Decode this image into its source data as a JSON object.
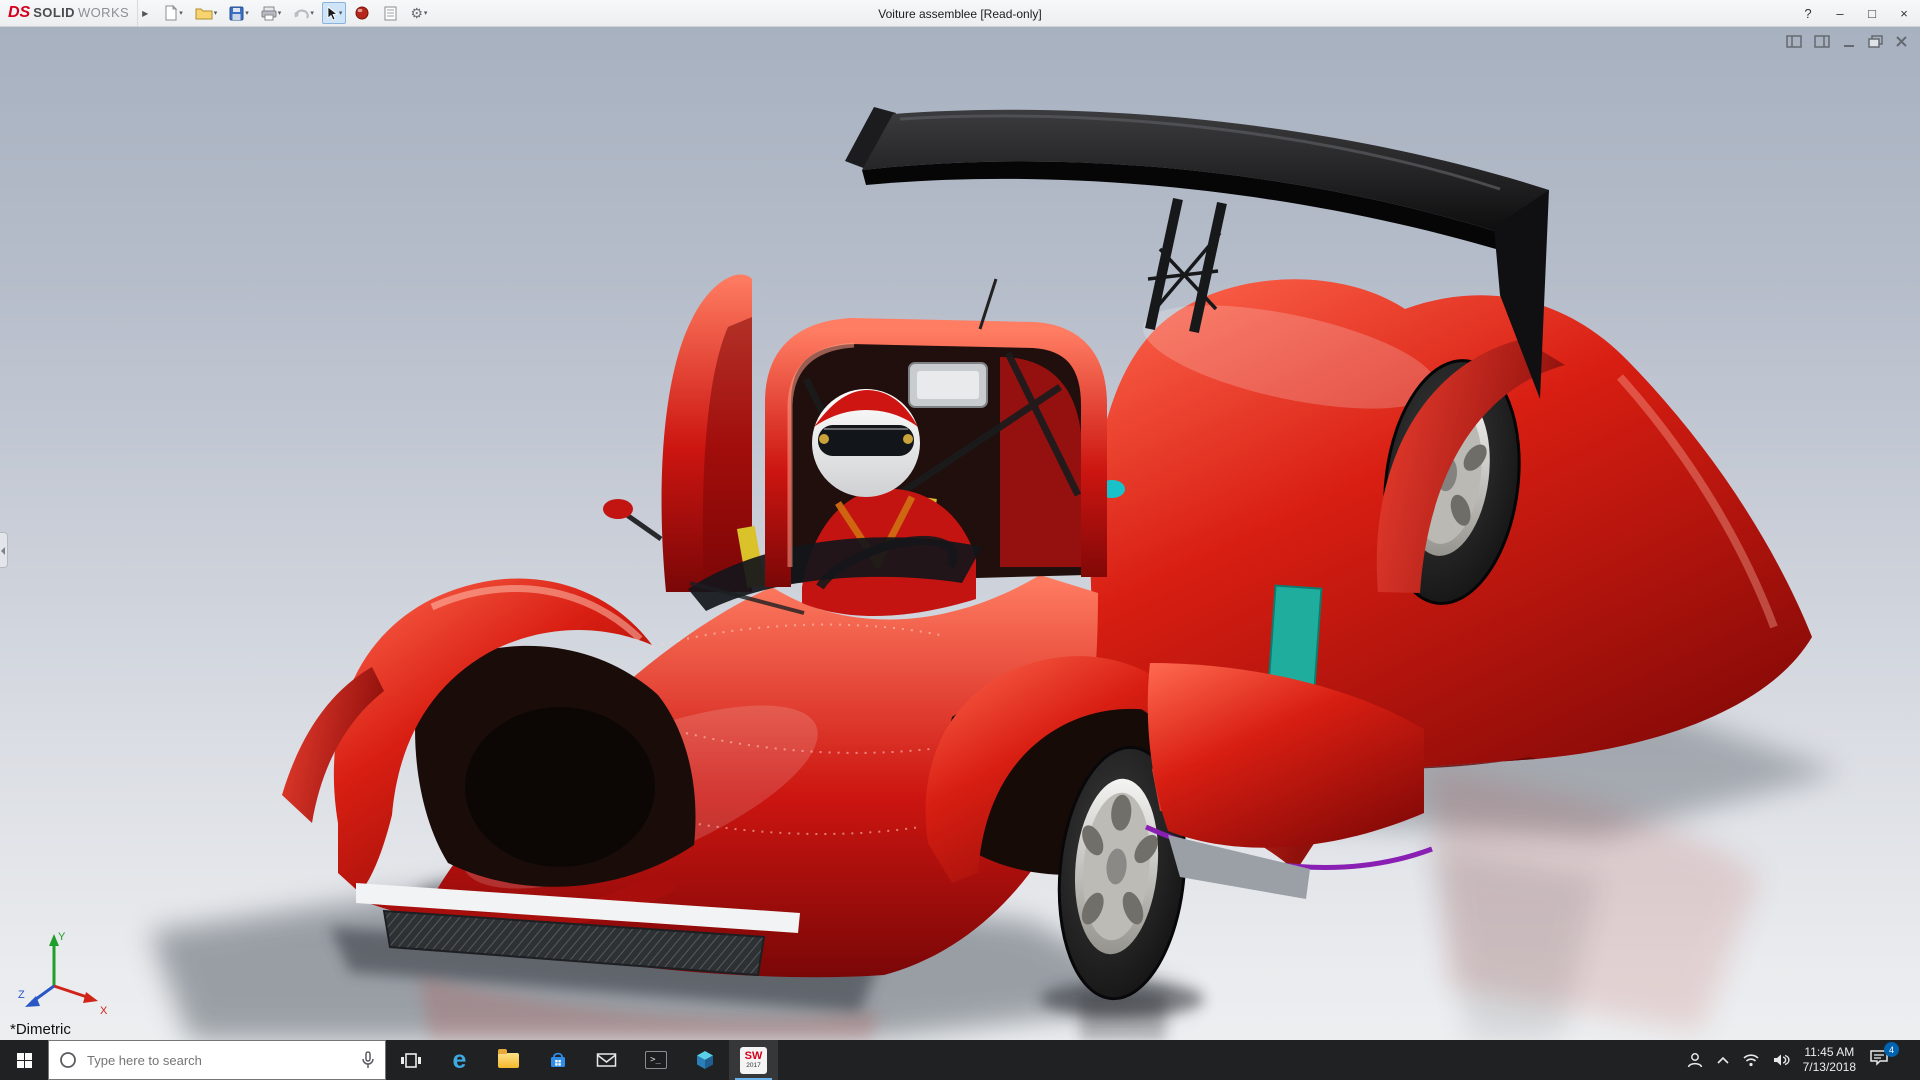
{
  "colors": {
    "car_red": "#d01712",
    "wing_black": "#111214",
    "accent_purple": "#8a1fb4",
    "accent_teal": "#1fae9e",
    "taskbar_bg": "#1f2123",
    "titlebar_bg": "#f2f3f5",
    "selection_blue": "#cfe4f7",
    "logo_red": "#d6001c"
  },
  "titlebar": {
    "logo_ds": "DS",
    "logo_solid": "SOLID",
    "logo_works": "WORKS",
    "flyout_glyph": "▶",
    "caret_glyph": "▾",
    "gear_glyph": "⚙",
    "document_title": "Voiture assemblee [Read-only]",
    "help_glyph": "?",
    "minimize_glyph": "–",
    "maximize_glyph": "□",
    "close_glyph": "×",
    "tools": [
      "new-document",
      "open-document",
      "save",
      "print",
      "undo",
      "select-tool",
      "appearance",
      "document-properties",
      "options"
    ]
  },
  "viewport": {
    "view_label": "*Dimetric",
    "triad_x": "X",
    "triad_y": "Y",
    "triad_z": "Z"
  },
  "taskbar": {
    "search_placeholder": "Type here to search",
    "edge_glyph": "e",
    "cmd_glyph": ">_",
    "sw_label": "SW",
    "sw_year": "2017",
    "clock_time": "11:45 AM",
    "clock_date": "7/13/2018",
    "action_badge": "4",
    "icons": [
      "start",
      "search",
      "task-view",
      "edge",
      "file-explorer",
      "store",
      "mail",
      "command-prompt",
      "3d-viewer",
      "solidworks"
    ],
    "tray_icons": [
      "people",
      "chevron-up",
      "wifi",
      "volume",
      "clock",
      "action-center"
    ]
  }
}
